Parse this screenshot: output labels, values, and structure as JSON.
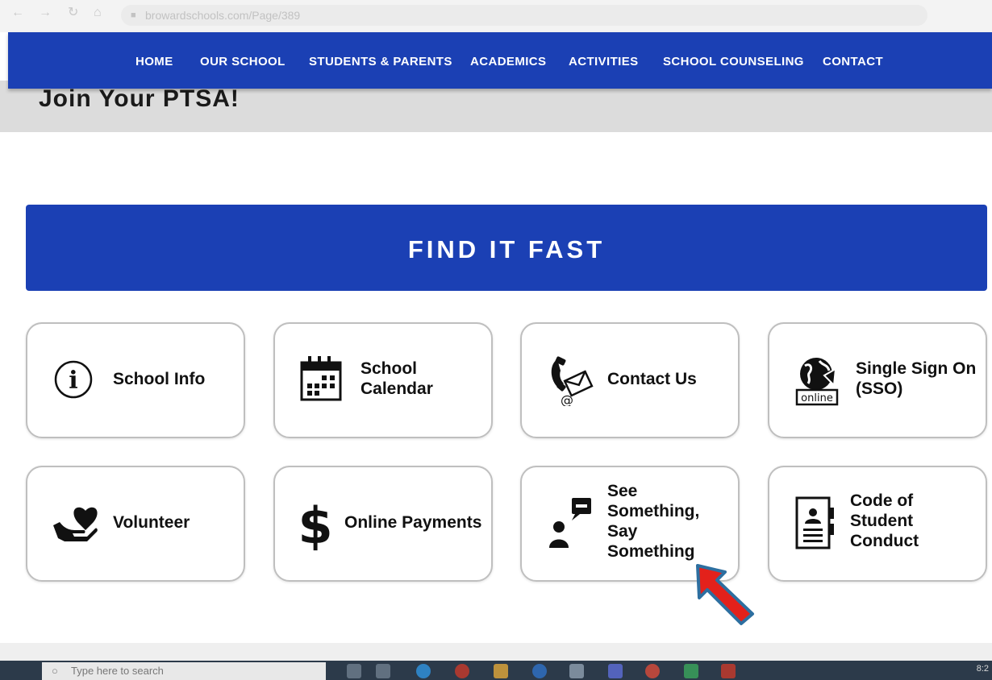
{
  "browser": {
    "url": "browardschools.com/Page/389"
  },
  "nav": {
    "items": [
      {
        "label": "HOME"
      },
      {
        "label": "OUR SCHOOL"
      },
      {
        "label": "STUDENTS & PARENTS"
      },
      {
        "label": "ACADEMICS"
      },
      {
        "label": "ACTIVITIES"
      },
      {
        "label": "SCHOOL COUNSELING"
      },
      {
        "label": "CONTACT"
      }
    ]
  },
  "band": {
    "partial_heading": "Join Your PTSA!"
  },
  "banner": {
    "title": "FIND IT FAST"
  },
  "cards": [
    {
      "label": "School Info",
      "icon": "info-icon"
    },
    {
      "label": "School\nCalendar",
      "icon": "calendar-icon"
    },
    {
      "label": "Contact Us",
      "icon": "phone-mail-icon"
    },
    {
      "label": "Single Sign On\n(SSO)",
      "icon": "online-globe-icon"
    },
    {
      "label": "Volunteer",
      "icon": "heart-hand-icon"
    },
    {
      "label": "Online Payments",
      "icon": "dollar-icon"
    },
    {
      "label": "See\nSomething,\nSay\nSomething",
      "icon": "person-speech-icon"
    },
    {
      "label": "Code of\nStudent\nConduct",
      "icon": "code-book-icon"
    }
  ],
  "taskbar": {
    "search_placeholder": "Type here to search",
    "clock": "8:2"
  },
  "colors": {
    "nav_blue": "#1b40b4",
    "arrow_fill": "#e3211b",
    "arrow_outline": "#2d6fa0"
  }
}
